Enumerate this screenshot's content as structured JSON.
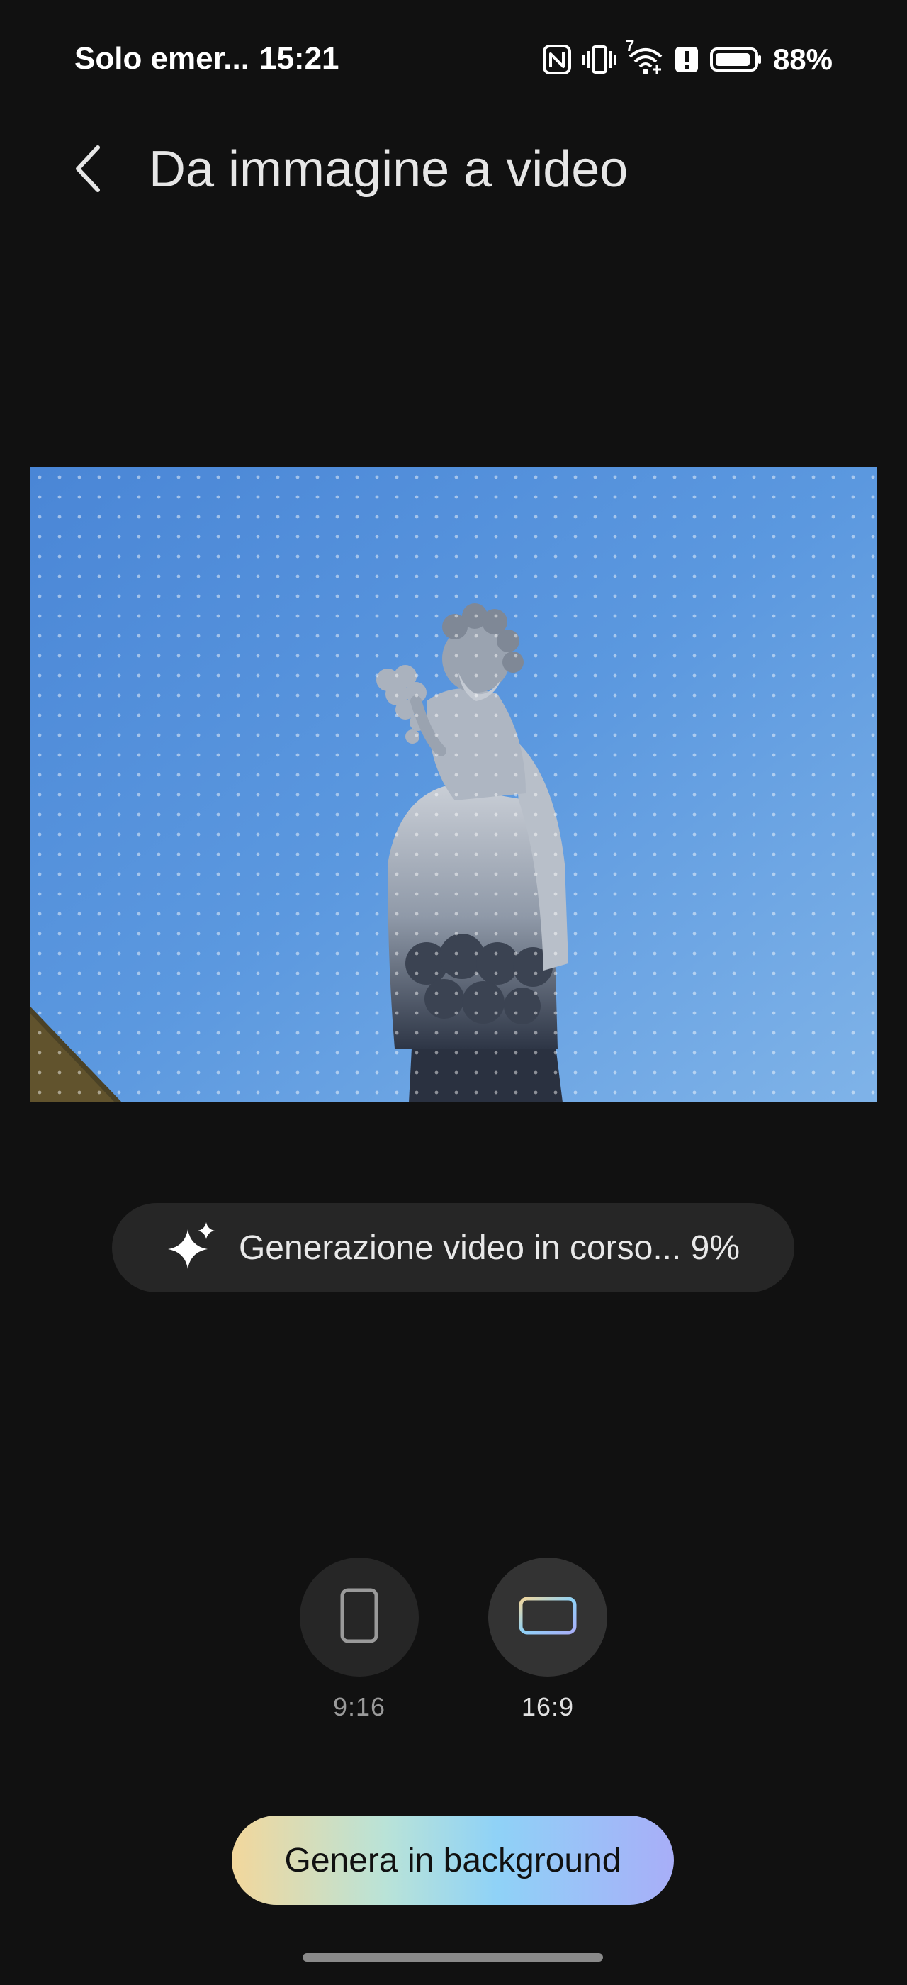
{
  "status_bar": {
    "carrier": "Solo emer...",
    "time": "15:21",
    "network_superscript": "7",
    "battery_percent": "88%",
    "icons": [
      "nfc-icon",
      "vibrate-icon",
      "wifi-icon",
      "alert-icon",
      "battery-icon"
    ]
  },
  "header": {
    "back_icon": "chevron-left-icon",
    "title": "Da immagine a video"
  },
  "preview": {
    "description_icon": "image-preview",
    "sky_color": "#5b97de"
  },
  "progress": {
    "icon": "sparkle-icon",
    "text": "Generazione video in corso... 9%",
    "percent": 9
  },
  "aspect_ratios": {
    "options": [
      {
        "label": "9:16",
        "icon": "portrait-frame-icon",
        "selected": false
      },
      {
        "label": "16:9",
        "icon": "landscape-frame-icon",
        "selected": true
      }
    ]
  },
  "actions": {
    "generate_background_label": "Genera in background"
  },
  "colors": {
    "background": "#111111",
    "pill": "#262626",
    "accent_gradient": [
      "#f2d79c",
      "#8fd2f7",
      "#a8aef8"
    ]
  }
}
